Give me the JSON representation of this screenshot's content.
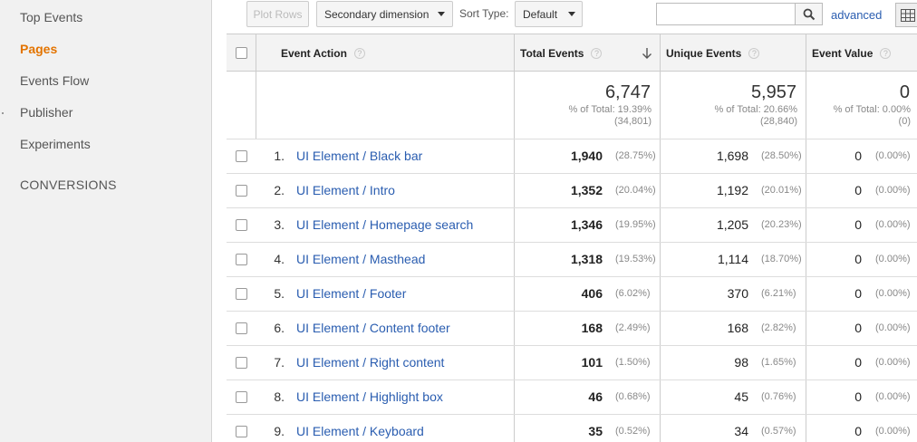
{
  "sidebar": {
    "items": [
      {
        "label": "Top Events",
        "active": false
      },
      {
        "label": "Pages",
        "active": true
      },
      {
        "label": "Events Flow",
        "active": false
      },
      {
        "label": "Publisher",
        "active": false
      },
      {
        "label": "Experiments",
        "active": false
      }
    ],
    "section_label": "CONVERSIONS"
  },
  "toolbar": {
    "plot_rows_label": "Plot Rows",
    "secondary_dimension_label": "Secondary dimension",
    "sort_type_label": "Sort Type:",
    "sort_type_value": "Default",
    "search_value": "",
    "advanced_label": "advanced"
  },
  "table": {
    "headers": {
      "event_action": "Event Action",
      "total_events": "Total Events",
      "unique_events": "Unique Events",
      "event_value": "Event Value"
    },
    "totals": {
      "total_events": "6,747",
      "total_events_pct": "% of Total: 19.39%",
      "total_events_of": "(34,801)",
      "unique_events": "5,957",
      "unique_events_pct": "% of Total: 20.66%",
      "unique_events_of": "(28,840)",
      "event_value": "0",
      "event_value_pct": "% of Total: 0.00%",
      "event_value_of": "(0)"
    },
    "rows": [
      {
        "rank": "1.",
        "action": "UI Element / Black bar",
        "total": "1,940",
        "total_pct": "(28.75%)",
        "unique": "1,698",
        "unique_pct": "(28.50%)",
        "value": "0",
        "value_pct": "(0.00%)"
      },
      {
        "rank": "2.",
        "action": "UI Element / Intro",
        "total": "1,352",
        "total_pct": "(20.04%)",
        "unique": "1,192",
        "unique_pct": "(20.01%)",
        "value": "0",
        "value_pct": "(0.00%)"
      },
      {
        "rank": "3.",
        "action": "UI Element / Homepage search",
        "total": "1,346",
        "total_pct": "(19.95%)",
        "unique": "1,205",
        "unique_pct": "(20.23%)",
        "value": "0",
        "value_pct": "(0.00%)"
      },
      {
        "rank": "4.",
        "action": "UI Element / Masthead",
        "total": "1,318",
        "total_pct": "(19.53%)",
        "unique": "1,114",
        "unique_pct": "(18.70%)",
        "value": "0",
        "value_pct": "(0.00%)"
      },
      {
        "rank": "5.",
        "action": "UI Element / Footer",
        "total": "406",
        "total_pct": "(6.02%)",
        "unique": "370",
        "unique_pct": "(6.21%)",
        "value": "0",
        "value_pct": "(0.00%)"
      },
      {
        "rank": "6.",
        "action": "UI Element / Content footer",
        "total": "168",
        "total_pct": "(2.49%)",
        "unique": "168",
        "unique_pct": "(2.82%)",
        "value": "0",
        "value_pct": "(0.00%)"
      },
      {
        "rank": "7.",
        "action": "UI Element / Right content",
        "total": "101",
        "total_pct": "(1.50%)",
        "unique": "98",
        "unique_pct": "(1.65%)",
        "value": "0",
        "value_pct": "(0.00%)"
      },
      {
        "rank": "8.",
        "action": "UI Element / Highlight box",
        "total": "46",
        "total_pct": "(0.68%)",
        "unique": "45",
        "unique_pct": "(0.76%)",
        "value": "0",
        "value_pct": "(0.00%)"
      },
      {
        "rank": "9.",
        "action": "UI Element / Keyboard",
        "total": "35",
        "total_pct": "(0.52%)",
        "unique": "34",
        "unique_pct": "(0.57%)",
        "value": "0",
        "value_pct": "(0.00%)"
      }
    ]
  },
  "colors": {
    "link": "#2a5db0",
    "active_nav": "#e37400",
    "sidebar_bg": "#f1f1f1"
  }
}
